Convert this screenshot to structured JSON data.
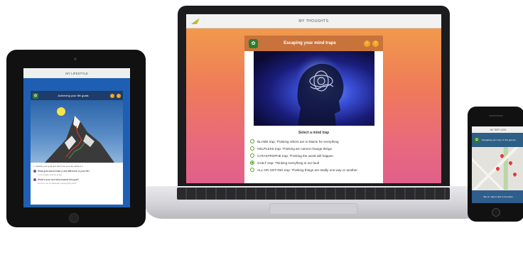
{
  "laptop": {
    "app_title": "MY THOUGHTS",
    "card_title": "Escaping your mind traps",
    "info_btn": "i",
    "help_btn": "?",
    "prompt": "Select a mind trap",
    "options": [
      {
        "label": "BLAME trap: Thinking others are to blame for everything",
        "checked": false
      },
      {
        "label": "HELPLESS trap: Thinking we cannot change things",
        "checked": false
      },
      {
        "label": "CATASTROPHE trap: Thinking the worst will happen",
        "checked": false
      },
      {
        "label": "GUILT trap: Thinking everything is our fault",
        "checked": true
      },
      {
        "label": "ALL OR NOT-ING trap: Thinking things are totally one way or another",
        "checked": false
      }
    ]
  },
  "tablet": {
    "app_title": "MY LIFESTYLE",
    "card_title": "Achieving your life goals",
    "intro": "1. Identify your goal and plan how you can achieve it",
    "q1": "What goal would make a real difference to your life?",
    "a1": "To be healthy and be active",
    "q2": "What is your next step towards this goal?",
    "a2": "Go for a run on Saturday morning this week"
  },
  "phone": {
    "app_title": "MY TRIP LOGS",
    "card_title": "Navigating your way / to the grocery",
    "footer": "Tap on map to add a new place"
  },
  "colors": {
    "accent_green": "#5aa02c",
    "brand_green": "#2e7d32",
    "laptop_header": "#c8733c",
    "tablet_bg": "#1f5fb3"
  }
}
